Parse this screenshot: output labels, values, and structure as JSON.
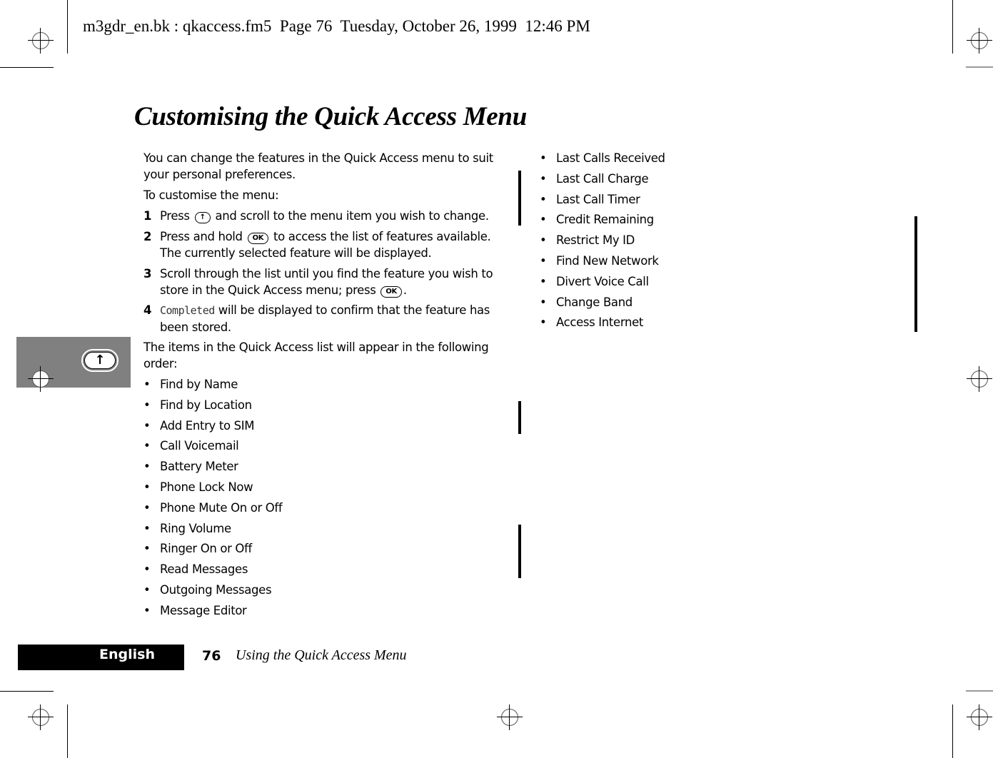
{
  "slug": "m3gdr_en.bk : qkaccess.fm5  Page 76  Tuesday, October 26, 1999  12:46 PM",
  "title": "Customising the Quick Access Menu",
  "intro": "You can change the features in the Quick Access menu to suit your personal preferences.",
  "lead": "To customise the menu:",
  "steps": [
    {
      "num": "1",
      "before": "Press",
      "key": "↑",
      "after": "and scroll to the menu item you wish to change."
    },
    {
      "num": "2",
      "before": "Press and hold",
      "key": "OK",
      "after": "to access the list of features available. The currently selected feature will be displayed."
    },
    {
      "num": "3",
      "before": "Scroll through the list until you find the feature you wish to store in the Quick Access menu; press",
      "key": "OK",
      "after": "."
    },
    {
      "num": "4",
      "lcd": "Completed",
      "after": "will be displayed to confirm that the feature has been stored."
    }
  ],
  "order_intro": "The items in the Quick Access list will appear in the following order:",
  "bullet": "•",
  "list_left": [
    "Find by Name",
    "Find by Location",
    "Add Entry to SIM",
    "Call Voicemail",
    "Battery Meter",
    "Phone Lock Now",
    "Phone Mute On or Off",
    "Ring Volume",
    "Ringer On or Off",
    "Read Messages",
    "Outgoing Messages",
    "Message Editor"
  ],
  "list_right": [
    "Last Calls Received",
    "Last Call Charge",
    "Last Call Timer",
    "Credit Remaining",
    "Restrict My ID",
    "Find New Network",
    "Divert Voice Call",
    "Change Band",
    "Access Internet"
  ],
  "thumb_key": "↑",
  "footer": {
    "language_tab": "English",
    "page_number": "76",
    "running_title": "Using the Quick Access Menu"
  }
}
